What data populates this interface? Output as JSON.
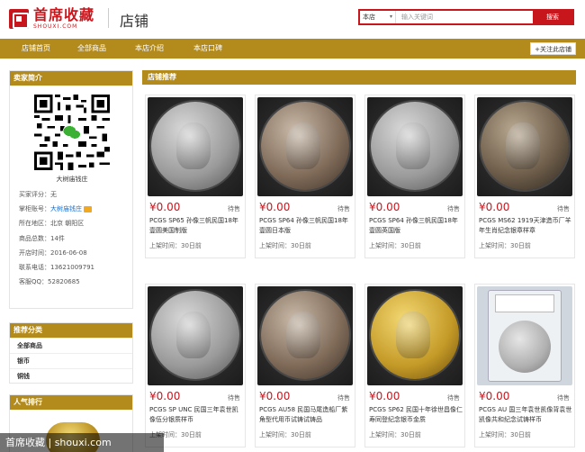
{
  "header": {
    "logo_cn": "首席收藏",
    "logo_en": "SHOUXI.COM",
    "shop_title": "店铺"
  },
  "search": {
    "scope": "本店",
    "placeholder": "输入关键词",
    "button": "搜索"
  },
  "nav": {
    "items": [
      "店铺首页",
      "全部商品",
      "本店介绍",
      "本店口碑"
    ],
    "follow": "+关注此店铺"
  },
  "seller": {
    "heading": "卖家简介",
    "name": "大树庙钱庄",
    "rows": [
      {
        "label": "买家评分：",
        "value": "无"
      },
      {
        "label": "掌柜账号：",
        "value": "大树庙钱庄"
      },
      {
        "label": "所在地区：",
        "value": "北京 朝阳区"
      },
      {
        "label": "商品总数：",
        "value": "14件"
      },
      {
        "label": "开店时间：",
        "value": "2016-06-08"
      },
      {
        "label": "联系电话：",
        "value": "13621009791"
      },
      {
        "label": "客服QQ：",
        "value": "52820685"
      }
    ]
  },
  "categories": {
    "heading": "推荐分类",
    "items": [
      "全部商品",
      "银币",
      "铜钱"
    ]
  },
  "popular": {
    "heading": "人气排行"
  },
  "main": {
    "heading": "店铺推荐",
    "products": [
      {
        "price": "¥0.00",
        "status": "待售",
        "title": "PCGS SP65 孙像三帆民国18年壹圆美国制版",
        "time": "上架时间：30日前",
        "coin": "silver"
      },
      {
        "price": "¥0.00",
        "status": "待售",
        "title": "PCGS SP64 孙像三帆民国18年壹圆日本版",
        "time": "上架时间：30日前",
        "coin": "toned"
      },
      {
        "price": "¥0.00",
        "status": "待售",
        "title": "PCGS SP64 孙像三帆民国18年壹圆英国版",
        "time": "上架时间：30日前",
        "coin": "silver"
      },
      {
        "price": "¥0.00",
        "status": "待售",
        "title": "PCGS MS62 1919天津造币厂羊年生肖纪念银章样章",
        "time": "上架时间：30日前",
        "coin": "dark"
      },
      {
        "price": "¥0.00",
        "status": "待售",
        "title": "PCGS SP UNC 民国三年袁世凯像伍分银质样币",
        "time": "上架时间：30日前",
        "coin": "silver"
      },
      {
        "price": "¥0.00",
        "status": "待售",
        "title": "PCGS AU58 民国马尾造船厂紫角型代用币试铸试铸品",
        "time": "上架时间：30日前",
        "coin": "toned"
      },
      {
        "price": "¥0.00",
        "status": "待售",
        "title": "PCGS SP62 民国十年徐世昌像仁寿同登纪念银币金质",
        "time": "上架时间：30日前",
        "coin": "gold"
      },
      {
        "price": "¥0.00",
        "status": "待售",
        "title": "PCGS AU 国三年袁世凯像背袁世凯像共和纪念试铸样币",
        "time": "上架时间：30日前",
        "coin": "slab"
      }
    ]
  },
  "watermark": "首席收藏 | shouxi.com",
  "colors": {
    "brand_red": "#c8161d",
    "nav_gold": "#b38b1d",
    "price_red": "#c8161d"
  }
}
